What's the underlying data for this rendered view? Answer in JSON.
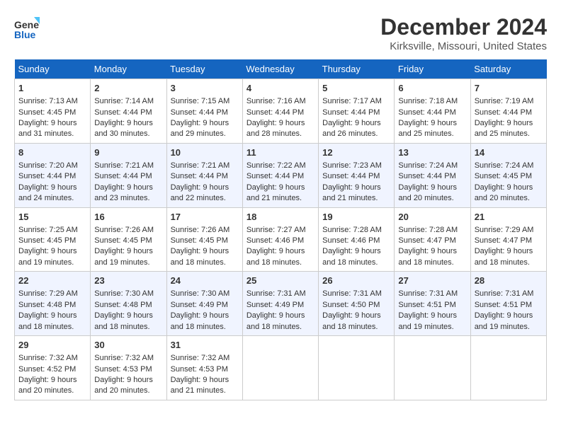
{
  "header": {
    "logo_line1": "General",
    "logo_line2": "Blue",
    "title": "December 2024",
    "subtitle": "Kirksville, Missouri, United States"
  },
  "days_of_week": [
    "Sunday",
    "Monday",
    "Tuesday",
    "Wednesday",
    "Thursday",
    "Friday",
    "Saturday"
  ],
  "weeks": [
    [
      {
        "day": "1",
        "sunrise": "7:13 AM",
        "sunset": "4:45 PM",
        "daylight": "9 hours and 31 minutes."
      },
      {
        "day": "2",
        "sunrise": "7:14 AM",
        "sunset": "4:44 PM",
        "daylight": "9 hours and 30 minutes."
      },
      {
        "day": "3",
        "sunrise": "7:15 AM",
        "sunset": "4:44 PM",
        "daylight": "9 hours and 29 minutes."
      },
      {
        "day": "4",
        "sunrise": "7:16 AM",
        "sunset": "4:44 PM",
        "daylight": "9 hours and 28 minutes."
      },
      {
        "day": "5",
        "sunrise": "7:17 AM",
        "sunset": "4:44 PM",
        "daylight": "9 hours and 26 minutes."
      },
      {
        "day": "6",
        "sunrise": "7:18 AM",
        "sunset": "4:44 PM",
        "daylight": "9 hours and 25 minutes."
      },
      {
        "day": "7",
        "sunrise": "7:19 AM",
        "sunset": "4:44 PM",
        "daylight": "9 hours and 25 minutes."
      }
    ],
    [
      {
        "day": "8",
        "sunrise": "7:20 AM",
        "sunset": "4:44 PM",
        "daylight": "9 hours and 24 minutes."
      },
      {
        "day": "9",
        "sunrise": "7:21 AM",
        "sunset": "4:44 PM",
        "daylight": "9 hours and 23 minutes."
      },
      {
        "day": "10",
        "sunrise": "7:21 AM",
        "sunset": "4:44 PM",
        "daylight": "9 hours and 22 minutes."
      },
      {
        "day": "11",
        "sunrise": "7:22 AM",
        "sunset": "4:44 PM",
        "daylight": "9 hours and 21 minutes."
      },
      {
        "day": "12",
        "sunrise": "7:23 AM",
        "sunset": "4:44 PM",
        "daylight": "9 hours and 21 minutes."
      },
      {
        "day": "13",
        "sunrise": "7:24 AM",
        "sunset": "4:44 PM",
        "daylight": "9 hours and 20 minutes."
      },
      {
        "day": "14",
        "sunrise": "7:24 AM",
        "sunset": "4:45 PM",
        "daylight": "9 hours and 20 minutes."
      }
    ],
    [
      {
        "day": "15",
        "sunrise": "7:25 AM",
        "sunset": "4:45 PM",
        "daylight": "9 hours and 19 minutes."
      },
      {
        "day": "16",
        "sunrise": "7:26 AM",
        "sunset": "4:45 PM",
        "daylight": "9 hours and 19 minutes."
      },
      {
        "day": "17",
        "sunrise": "7:26 AM",
        "sunset": "4:45 PM",
        "daylight": "9 hours and 18 minutes."
      },
      {
        "day": "18",
        "sunrise": "7:27 AM",
        "sunset": "4:46 PM",
        "daylight": "9 hours and 18 minutes."
      },
      {
        "day": "19",
        "sunrise": "7:28 AM",
        "sunset": "4:46 PM",
        "daylight": "9 hours and 18 minutes."
      },
      {
        "day": "20",
        "sunrise": "7:28 AM",
        "sunset": "4:47 PM",
        "daylight": "9 hours and 18 minutes."
      },
      {
        "day": "21",
        "sunrise": "7:29 AM",
        "sunset": "4:47 PM",
        "daylight": "9 hours and 18 minutes."
      }
    ],
    [
      {
        "day": "22",
        "sunrise": "7:29 AM",
        "sunset": "4:48 PM",
        "daylight": "9 hours and 18 minutes."
      },
      {
        "day": "23",
        "sunrise": "7:30 AM",
        "sunset": "4:48 PM",
        "daylight": "9 hours and 18 minutes."
      },
      {
        "day": "24",
        "sunrise": "7:30 AM",
        "sunset": "4:49 PM",
        "daylight": "9 hours and 18 minutes."
      },
      {
        "day": "25",
        "sunrise": "7:31 AM",
        "sunset": "4:49 PM",
        "daylight": "9 hours and 18 minutes."
      },
      {
        "day": "26",
        "sunrise": "7:31 AM",
        "sunset": "4:50 PM",
        "daylight": "9 hours and 18 minutes."
      },
      {
        "day": "27",
        "sunrise": "7:31 AM",
        "sunset": "4:51 PM",
        "daylight": "9 hours and 19 minutes."
      },
      {
        "day": "28",
        "sunrise": "7:31 AM",
        "sunset": "4:51 PM",
        "daylight": "9 hours and 19 minutes."
      }
    ],
    [
      {
        "day": "29",
        "sunrise": "7:32 AM",
        "sunset": "4:52 PM",
        "daylight": "9 hours and 20 minutes."
      },
      {
        "day": "30",
        "sunrise": "7:32 AM",
        "sunset": "4:53 PM",
        "daylight": "9 hours and 20 minutes."
      },
      {
        "day": "31",
        "sunrise": "7:32 AM",
        "sunset": "4:53 PM",
        "daylight": "9 hours and 21 minutes."
      },
      null,
      null,
      null,
      null
    ]
  ]
}
